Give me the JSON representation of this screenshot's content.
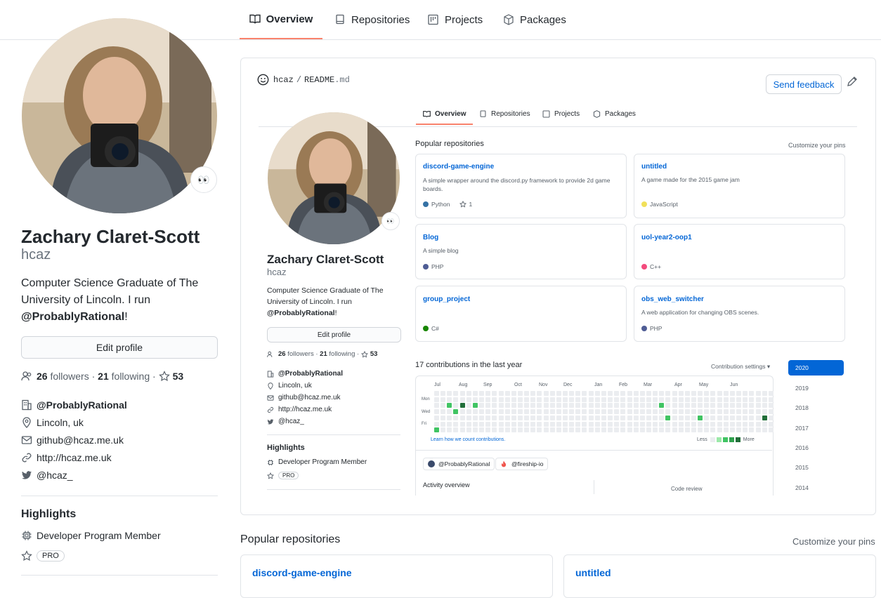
{
  "tabs": [
    {
      "label": "Overview"
    },
    {
      "label": "Repositories"
    },
    {
      "label": "Projects"
    },
    {
      "label": "Packages"
    }
  ],
  "profile": {
    "name": "Zachary Claret-Scott",
    "login": "hcaz",
    "bio_1": "Computer Science Graduate of The University of Lincoln. I run ",
    "bio_handle": "@ProbablyRational",
    "bio_end": "!",
    "edit_label": "Edit profile",
    "followers_count": "26",
    "followers_label": "followers",
    "following_count": "21",
    "following_label": "following",
    "stars": "53",
    "org": "@ProbablyRational",
    "location": "Lincoln, uk",
    "email": "github@hcaz.me.uk",
    "website": "http://hcaz.me.uk",
    "twitter": "@hcaz_",
    "highlights_title": "Highlights",
    "highlight_1": "Developer Program Member",
    "highlight_2": "PRO",
    "emoji": "👀"
  },
  "readme": {
    "owner": "hcaz",
    "sep": "/",
    "file_base": "README",
    "file_ext": ".md",
    "feedback_label": "Send feedback",
    "popular_title": "Popular repositories",
    "customize": "Customize your pins",
    "pins": [
      {
        "name": "discord-game-engine",
        "desc": "A simple wrapper around the discord.py framework to provide 2d game boards.",
        "lang": "Python",
        "color": "#3572A5",
        "stars": "1"
      },
      {
        "name": "untitled",
        "desc": "A game made for the 2015 game jam",
        "lang": "JavaScript",
        "color": "#f1e05a",
        "stars": ""
      },
      {
        "name": "Blog",
        "desc": "A simple blog",
        "lang": "PHP",
        "color": "#4F5D95",
        "stars": ""
      },
      {
        "name": "uol-year2-oop1",
        "desc": "",
        "lang": "C++",
        "color": "#f34b7d",
        "stars": ""
      },
      {
        "name": "group_project",
        "desc": "",
        "lang": "C#",
        "color": "#178600",
        "stars": ""
      },
      {
        "name": "obs_web_switcher",
        "desc": "A web application for changing OBS scenes.",
        "lang": "PHP",
        "color": "#4F5D95",
        "stars": ""
      }
    ],
    "contrib_title": "17 contributions in the last year",
    "contrib_settings": "Contribution settings ▾",
    "months": [
      "Jul",
      "Aug",
      "Sep",
      "Oct",
      "Nov",
      "Dec",
      "Jan",
      "Feb",
      "Mar",
      "Apr",
      "May",
      "Jun"
    ],
    "days": [
      "Mon",
      "Wed",
      "Fri"
    ],
    "learn": "Learn how we count contributions.",
    "less": "Less",
    "more": "More",
    "years": [
      "2020",
      "2019",
      "2018",
      "2017",
      "2016",
      "2015",
      "2014"
    ],
    "orgs": [
      "@ProbablyRational",
      "@fireship-io"
    ],
    "activity": "Activity overview",
    "code_review": "Code review"
  },
  "bottom": {
    "popular_title": "Popular repositories",
    "customize": "Customize your pins",
    "repo_1": "discord-game-engine",
    "repo_2": "untitled"
  },
  "colors": {
    "accent": "#f9826c",
    "link": "#0366d6",
    "green_1": "#9be9a8",
    "green_2": "#40c463",
    "green_3": "#30a14e",
    "green_4": "#216e39"
  }
}
